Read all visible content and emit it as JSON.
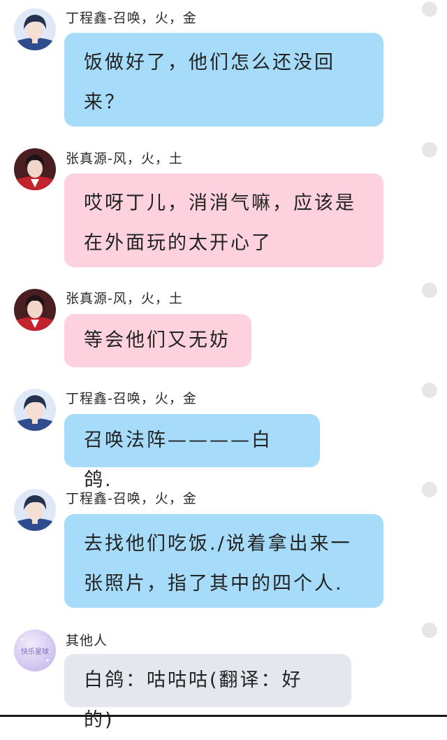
{
  "messages": [
    {
      "sender": "丁程鑫-召唤，火，金",
      "text": "饭做好了，他们怎么还没回来？",
      "bubble_color": "#a6dcfa",
      "avatar": "boy-blue-avatar-icon"
    },
    {
      "sender": "张真源-风，火，土",
      "text": "哎呀丁儿，消消气嘛，应该是在外面玩的太开心了",
      "bubble_color": "#fdd2de",
      "avatar": "boy-red-avatar-icon"
    },
    {
      "sender": "张真源-风，火，土",
      "text": "等会他们又无妨",
      "bubble_color": "#fdd2de",
      "avatar": "boy-red-avatar-icon"
    },
    {
      "sender": "丁程鑫-召唤，火，金",
      "text": "召唤法阵————白鸽.",
      "bubble_color": "#a6dcfa",
      "avatar": "boy-blue-avatar-icon"
    },
    {
      "sender": "丁程鑫-召唤，火，金",
      "text": "去找他们吃饭./说着拿出来一张照片，指了其中的四个人.",
      "bubble_color": "#a6dcfa",
      "avatar": "boy-blue-avatar-icon"
    },
    {
      "sender": "其他人",
      "text": "白鸽：咕咕咕(翻译：好的)",
      "bubble_color": "#e4e7ed",
      "avatar": "lavender-avatar-icon",
      "avatar_text": "快乐星球"
    }
  ]
}
